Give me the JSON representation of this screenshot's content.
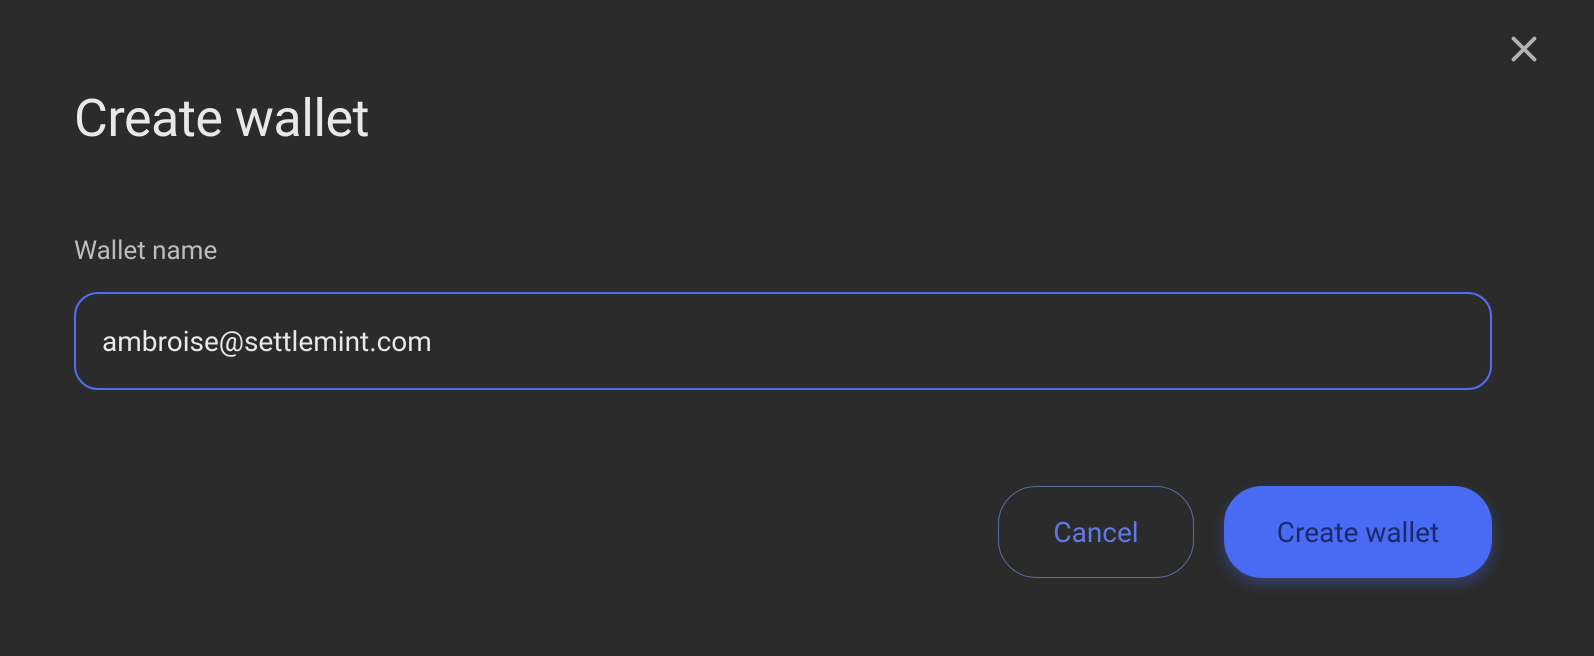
{
  "modal": {
    "title": "Create wallet",
    "close_icon": "close"
  },
  "form": {
    "wallet_name_label": "Wallet name",
    "wallet_name_value": "ambroise@settlemint.com"
  },
  "buttons": {
    "cancel": "Cancel",
    "submit": "Create wallet"
  }
}
